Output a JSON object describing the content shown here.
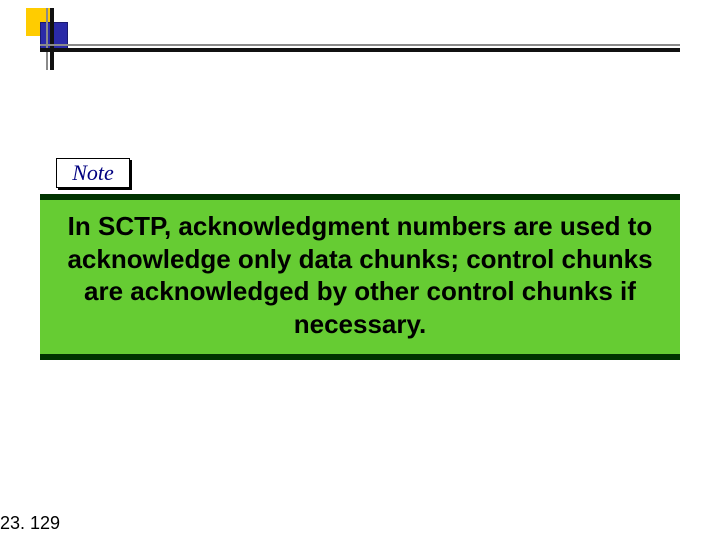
{
  "header": {
    "decor": {
      "square1": "yellow-square",
      "square2": "blue-square"
    }
  },
  "note": {
    "label": "Note",
    "body": "In SCTP, acknowledgment numbers are used to acknowledge only data chunks; control chunks are acknowledged by other control chunks if necessary."
  },
  "page_number": "23. 129",
  "colors": {
    "note_bg": "#66cc33",
    "note_border": "#003300",
    "label_text": "#000080",
    "accent_yellow": "#ffcc00",
    "accent_blue": "#2a2aa8"
  }
}
